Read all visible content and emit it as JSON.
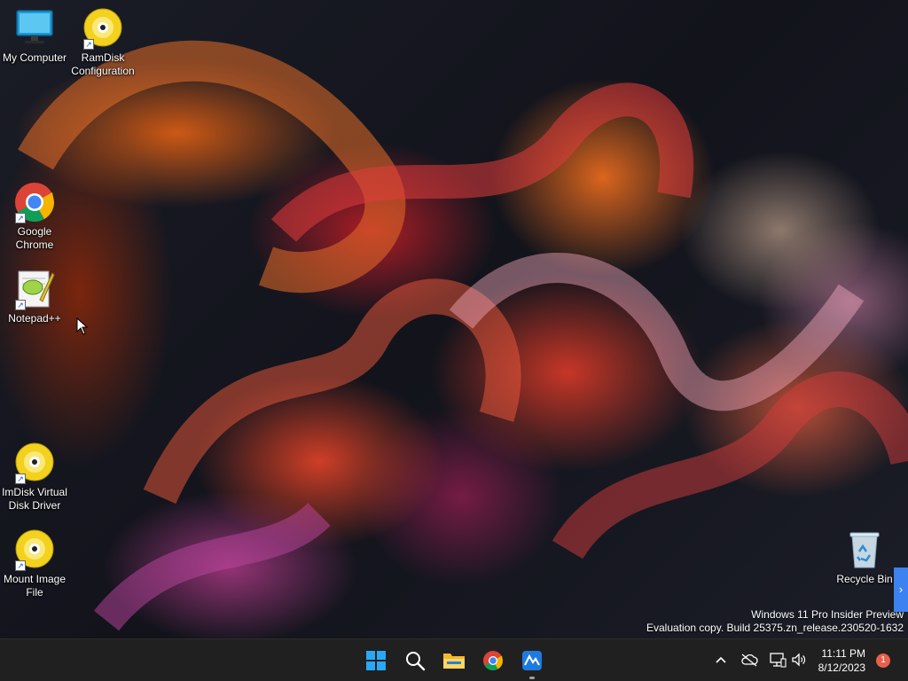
{
  "desktop_icons": {
    "my_computer": "My Computer",
    "ramdisk": "RamDisk Configuration",
    "chrome": "Google Chrome",
    "notepad": "Notepad++",
    "imdisk": "ImDisk Virtual Disk Driver",
    "mount_image": "Mount Image File",
    "recycle_bin": "Recycle Bin"
  },
  "watermark": {
    "line1": "Windows 11 Pro Insider Preview",
    "line2": "Evaluation copy. Build 25375.zn_release.230520-1632"
  },
  "taskbar": {
    "apps": [
      "start-icon",
      "search-icon",
      "file-explorer-icon",
      "chrome-icon",
      "app-icon"
    ],
    "tray": [
      "chevron-up-icon",
      "cloud-off-icon",
      "network-icon",
      "volume-icon"
    ],
    "time": "11:11 PM",
    "date": "8/12/2023",
    "notification_count": "1"
  },
  "colors": {
    "taskbar": "#202020",
    "accent": "#3c82f0",
    "badge": "#e8604c"
  }
}
